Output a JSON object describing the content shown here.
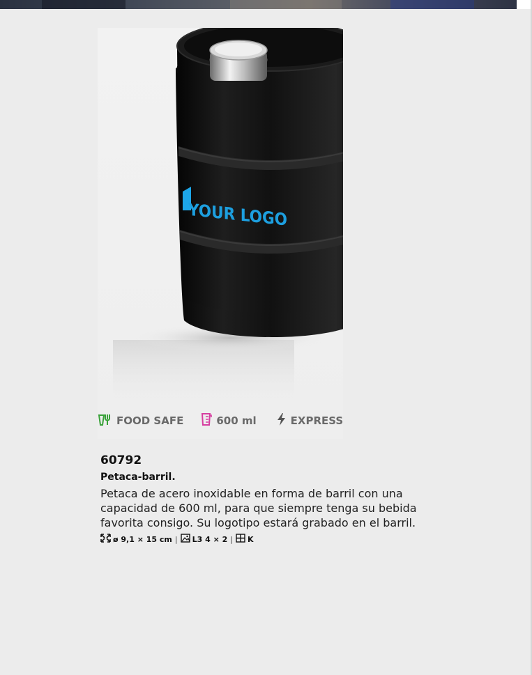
{
  "badges": {
    "food_safe": {
      "label": "FOOD SAFE",
      "icon": "food-safe-icon",
      "color": "#3aa23a"
    },
    "capacity": {
      "label": "600 ml",
      "icon": "measuring-cup-icon",
      "color": "#d63ea0"
    },
    "express": {
      "label": "EXPRESS",
      "icon": "lightning-icon",
      "color": "#555555"
    }
  },
  "product": {
    "sku": "60792",
    "name": "Petaca-barril.",
    "description": "Petaca de acero inoxidable en forma de barril con una capacidad de 600 ml, para que siempre tenga su bebida favorita consigo. Su logotipo estará grabado en el barril.",
    "image_logo_text": "YOUR LOGO",
    "specs": {
      "size": "ø 9,1 × 15 cm",
      "print": "L3 4 × 2",
      "packaging": "K",
      "separator": "|"
    }
  }
}
